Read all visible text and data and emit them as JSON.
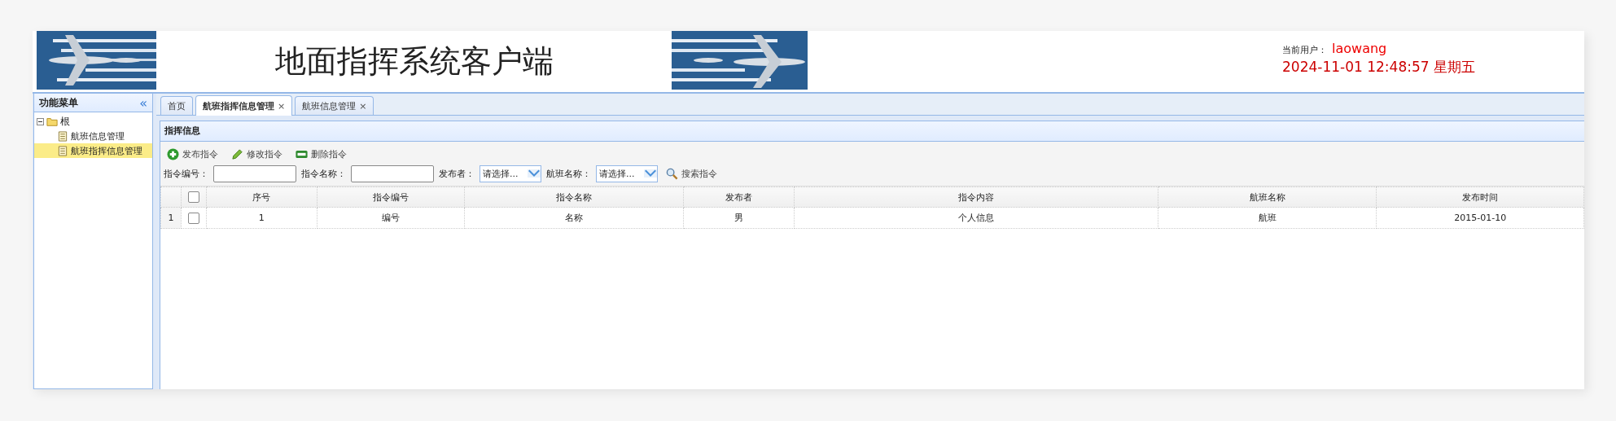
{
  "header": {
    "title": "地面指挥系统客户端",
    "user_label": "当前用户：",
    "user_name": "laowang",
    "datetime": "2024-11-01 12:48:57 星期五"
  },
  "sidebar": {
    "title": "功能菜单",
    "collapse_icon": "«",
    "tree": [
      {
        "label": "根",
        "expanded": true,
        "selected": false,
        "children": [
          {
            "label": "航班信息管理",
            "selected": false
          },
          {
            "label": "航班指挥信息管理",
            "selected": true
          }
        ]
      }
    ]
  },
  "tabs": [
    {
      "label": "首页",
      "selected": false,
      "closable": false
    },
    {
      "label": "航班指挥信息管理",
      "selected": true,
      "closable": true
    },
    {
      "label": "航班信息管理",
      "selected": false,
      "closable": true
    }
  ],
  "close_mark": "×",
  "panel": {
    "title": "指挥信息",
    "toolbar": [
      {
        "kind": "add",
        "label": "发布指令"
      },
      {
        "kind": "edit",
        "label": "修改指令"
      },
      {
        "kind": "remove",
        "label": "删除指令"
      }
    ],
    "filters": [
      {
        "kind": "text",
        "label": "指令编号："
      },
      {
        "kind": "text",
        "label": "指令名称："
      },
      {
        "kind": "select",
        "label": "发布者：",
        "placeholder": "请选择..."
      },
      {
        "kind": "select",
        "label": "航班名称：",
        "placeholder": "请选择..."
      }
    ],
    "search_button": "搜索指令",
    "table": {
      "header_checked": false,
      "columns": [
        "序号",
        "指令编号",
        "指令名称",
        "发布者",
        "指令内容",
        "航班名称",
        "发布时间"
      ],
      "rows": [
        {
          "row_number": "1",
          "checked": false,
          "cells": [
            "1",
            "编号",
            "名称",
            "男",
            "个人信息",
            "航班",
            "2015-01-10"
          ]
        }
      ]
    }
  }
}
